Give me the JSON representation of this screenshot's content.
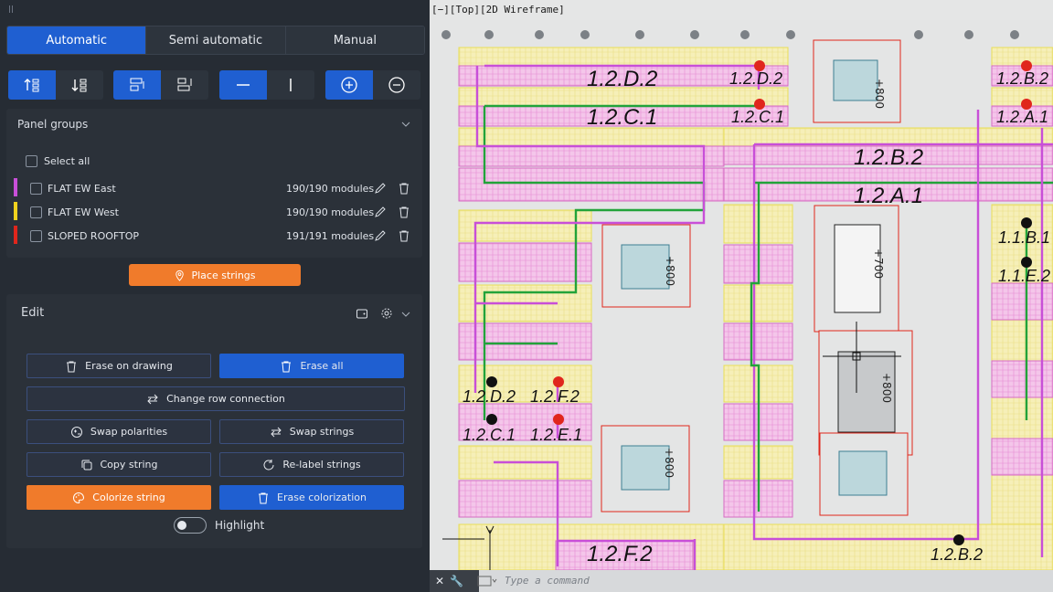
{
  "tabs": [
    {
      "label": "Automatic",
      "active": true
    },
    {
      "label": "Semi automatic",
      "active": false
    },
    {
      "label": "Manual",
      "active": false
    }
  ],
  "toolbar_icons": [
    "sort-ascending-icon",
    "sort-descending-icon",
    "align-rows-icon",
    "align-columns-icon",
    "horizontal-line-icon",
    "vertical-line-icon",
    "plus-circle-icon",
    "minus-circle-icon"
  ],
  "panel_groups": {
    "title": "Panel groups",
    "select_all": "Select all",
    "groups": [
      {
        "name": "FLAT EW East",
        "modules": "190/190 modules",
        "color": "#c84fd8"
      },
      {
        "name": "FLAT EW West",
        "modules": "190/190 modules",
        "color": "#f0d21e"
      },
      {
        "name": "SLOPED ROOFTOP",
        "modules": "191/191 modules",
        "color": "#e0261c"
      }
    ]
  },
  "place_strings_label": "Place strings",
  "edit": {
    "title": "Edit",
    "buttons": {
      "erase_on_drawing": "Erase on drawing",
      "erase_all": "Erase all",
      "change_row_connection": "Change row connection",
      "swap_polarities": "Swap polarities",
      "swap_strings": "Swap strings",
      "copy_string": "Copy string",
      "relabel_strings": "Re-label strings",
      "colorize_string": "Colorize string",
      "erase_colorization": "Erase colorization"
    },
    "highlight_label": "Highlight"
  },
  "viewport": {
    "title": "[−][Top][2D Wireframe]",
    "labels": {
      "l1": "1.2.D.2",
      "l2": "1.2.D.2",
      "l3": "1.2.C.1",
      "l4": "1.2.C.1",
      "l5": "1.2.B.2",
      "l6": "1.2.A.1",
      "l7": "1.2.B.2",
      "l8": "1.2.A.1",
      "l9": "1.1.B.1",
      "l10": "1.1.E.2",
      "l11": "1.2.D.2",
      "l12": "1.2.F.2",
      "l13": "1.2.C.1",
      "l14": "1.2.E.1",
      "l15": "1.2.F.2",
      "l16": "1.2.B.2",
      "l17": "1.2.E.1",
      "l18": "1.2.A.1"
    },
    "dims": {
      "d1": "+800",
      "d2": "+700",
      "d3": "+800",
      "d4": "+800",
      "d5": "+800"
    }
  },
  "command": {
    "placeholder": "Type a command"
  },
  "colors": {
    "accent": "#1f5fd1",
    "orange": "#f07b2b",
    "magenta": "#c84fd8",
    "yellow": "#f0d21e",
    "green": "#22a33a",
    "red": "#e0261c"
  }
}
